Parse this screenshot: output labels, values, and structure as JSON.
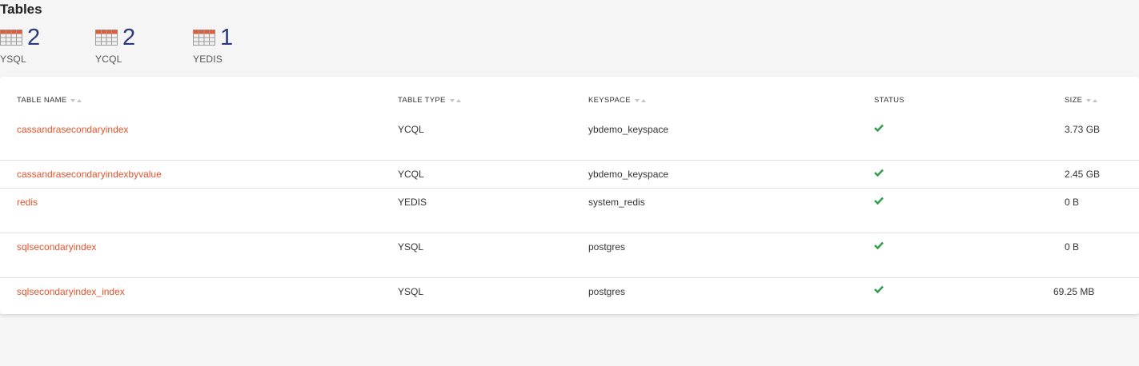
{
  "page": {
    "title": "Tables"
  },
  "summary": [
    {
      "count": "2",
      "label": "YSQL"
    },
    {
      "count": "2",
      "label": "YCQL"
    },
    {
      "count": "1",
      "label": "YEDIS"
    }
  ],
  "columns": {
    "name": "TABLE NAME",
    "type": "TABLE TYPE",
    "keyspace": "KEYSPACE",
    "status": "STATUS",
    "size": "SIZE"
  },
  "rows": [
    {
      "name": "cassandrasecondaryindex",
      "type": "YCQL",
      "keyspace": "ybdemo_keyspace",
      "status": "ok",
      "size": "3.73 GB"
    },
    {
      "name": "cassandrasecondaryindexbyvalue",
      "type": "YCQL",
      "keyspace": "ybdemo_keyspace",
      "status": "ok",
      "size": "2.45 GB"
    },
    {
      "name": "redis",
      "type": "YEDIS",
      "keyspace": "system_redis",
      "status": "ok",
      "size": "0 B"
    },
    {
      "name": "sqlsecondaryindex",
      "type": "YSQL",
      "keyspace": "postgres",
      "status": "ok",
      "size": "0 B"
    },
    {
      "name": "sqlsecondaryindex_index",
      "type": "YSQL",
      "keyspace": "postgres",
      "status": "ok",
      "size": "69.25 MB"
    }
  ],
  "colors": {
    "link": "#e0542c",
    "count": "#2b3a7a",
    "check": "#2e9d4a"
  },
  "icons": {
    "table": "table-grid-icon",
    "status_ok": "check-icon",
    "sort": "sort-arrows-icon"
  }
}
